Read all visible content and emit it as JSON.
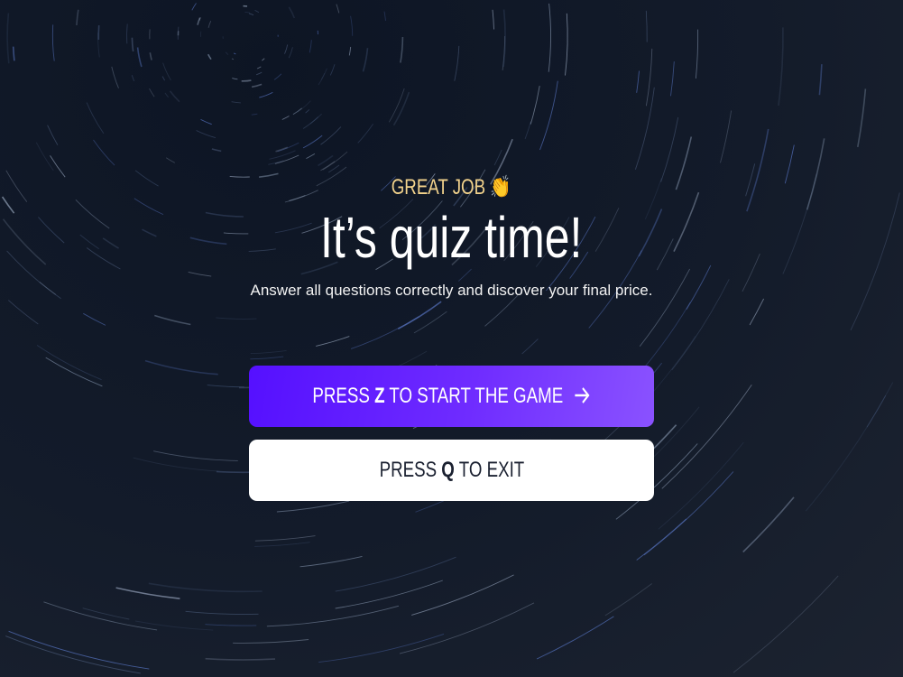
{
  "eyebrow": {
    "text": "GREAT JOB",
    "emoji": "👏"
  },
  "title": "It’s quiz time!",
  "subtitle": "Answer all questions correctly and discover your final price.",
  "buttons": {
    "start": {
      "prefix": "PRESS ",
      "key": "Z",
      "suffix": " TO START THE GAME",
      "icon": "arrow-right-icon"
    },
    "exit": {
      "prefix": "PRESS ",
      "key": "Q",
      "suffix": " TO EXIT"
    }
  },
  "colors": {
    "accent_start": "#5510ff",
    "accent_end": "#8a52ff",
    "eyebrow": "#f3d38c",
    "background": "#131b2a"
  }
}
